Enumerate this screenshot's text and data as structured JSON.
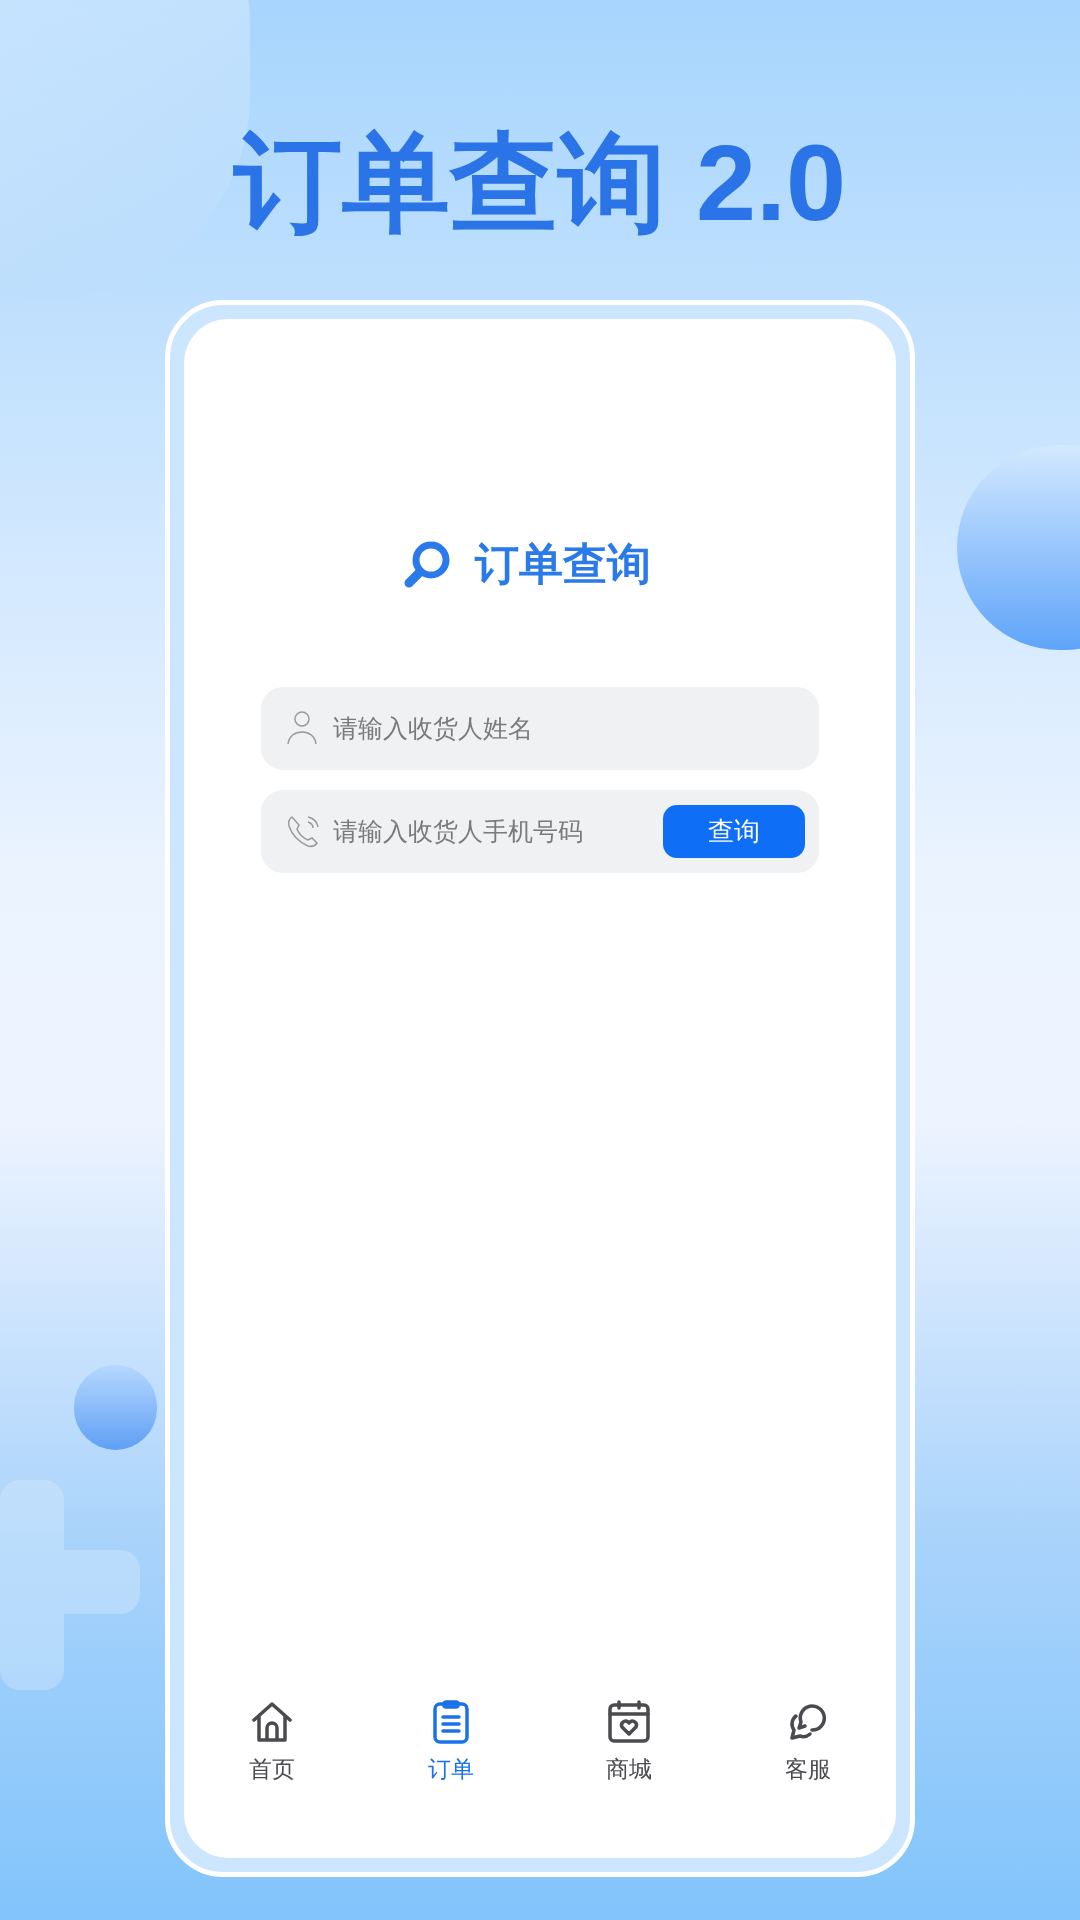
{
  "title": "订单查询 2.0",
  "card": {
    "heading": "订单查询",
    "fields": [
      {
        "kind": "name",
        "placeholder": "请输入收货人姓名"
      },
      {
        "kind": "phone",
        "placeholder": "请输入收货人手机号码",
        "button": "查询"
      }
    ]
  },
  "nav": [
    {
      "kind": "home",
      "label": "首页",
      "selected": false
    },
    {
      "kind": "orders",
      "label": "订单",
      "selected": true
    },
    {
      "kind": "mall",
      "label": "商城",
      "selected": false
    },
    {
      "kind": "service",
      "label": "客服",
      "selected": false
    }
  ]
}
